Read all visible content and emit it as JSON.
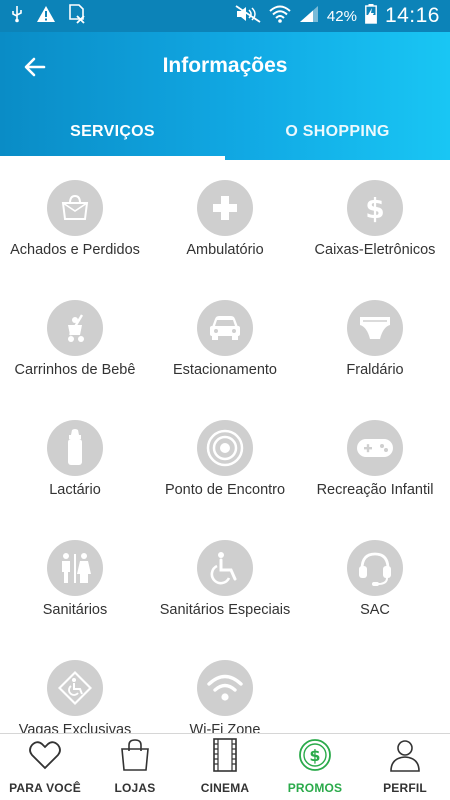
{
  "status_bar": {
    "icons": [
      "usb-icon",
      "warning-icon",
      "sim-off-icon",
      "mute-icon",
      "wifi-icon",
      "signal-icon",
      "battery-charging-icon"
    ],
    "battery": "42%",
    "time": "14:16"
  },
  "header": {
    "title": "Informações",
    "back_icon": "arrow-left-icon",
    "tabs": [
      {
        "label": "SERVIÇOS",
        "active": true
      },
      {
        "label": "O SHOPPING",
        "active": false
      }
    ],
    "gradient": [
      "#0a8cc6",
      "#19c6f4"
    ]
  },
  "services": [
    {
      "label": "Achados e Perdidos",
      "icon": "bag-icon"
    },
    {
      "label": "Ambulatório",
      "icon": "plus-icon"
    },
    {
      "label": "Caixas-Eletrônicos",
      "icon": "dollar-icon"
    },
    {
      "label": "Carrinhos de Bebê",
      "icon": "stroller-icon"
    },
    {
      "label": "Estacionamento",
      "icon": "car-icon"
    },
    {
      "label": "Fraldário",
      "icon": "diaper-icon"
    },
    {
      "label": "Lactário",
      "icon": "baby-bottle-icon"
    },
    {
      "label": "Ponto de Encontro",
      "icon": "target-icon"
    },
    {
      "label": "Recreação Infantil",
      "icon": "gamepad-icon"
    },
    {
      "label": "Sanitários",
      "icon": "restroom-icon"
    },
    {
      "label": "Sanitários Especiais",
      "icon": "wheelchair-icon"
    },
    {
      "label": "SAC",
      "icon": "headset-icon"
    },
    {
      "label": "Vagas Exclusivas",
      "icon": "accessible-parking-icon"
    },
    {
      "label": "Wi-Fi Zone",
      "icon": "wifi-icon"
    }
  ],
  "bottom_nav": [
    {
      "label": "PARA VOCÊ",
      "icon": "heart-icon",
      "active": false
    },
    {
      "label": "LOJAS",
      "icon": "shopping-bag-icon",
      "active": false
    },
    {
      "label": "CINEMA",
      "icon": "film-icon",
      "active": false
    },
    {
      "label": "PROMOS",
      "icon": "dollar-coin-icon",
      "active": true
    },
    {
      "label": "PERFIL",
      "icon": "user-icon",
      "active": false
    }
  ],
  "colors": {
    "accent_green": "#2aaa4a",
    "icon_circle": "#cfcfcf",
    "status_bar": "#0c83b8"
  }
}
